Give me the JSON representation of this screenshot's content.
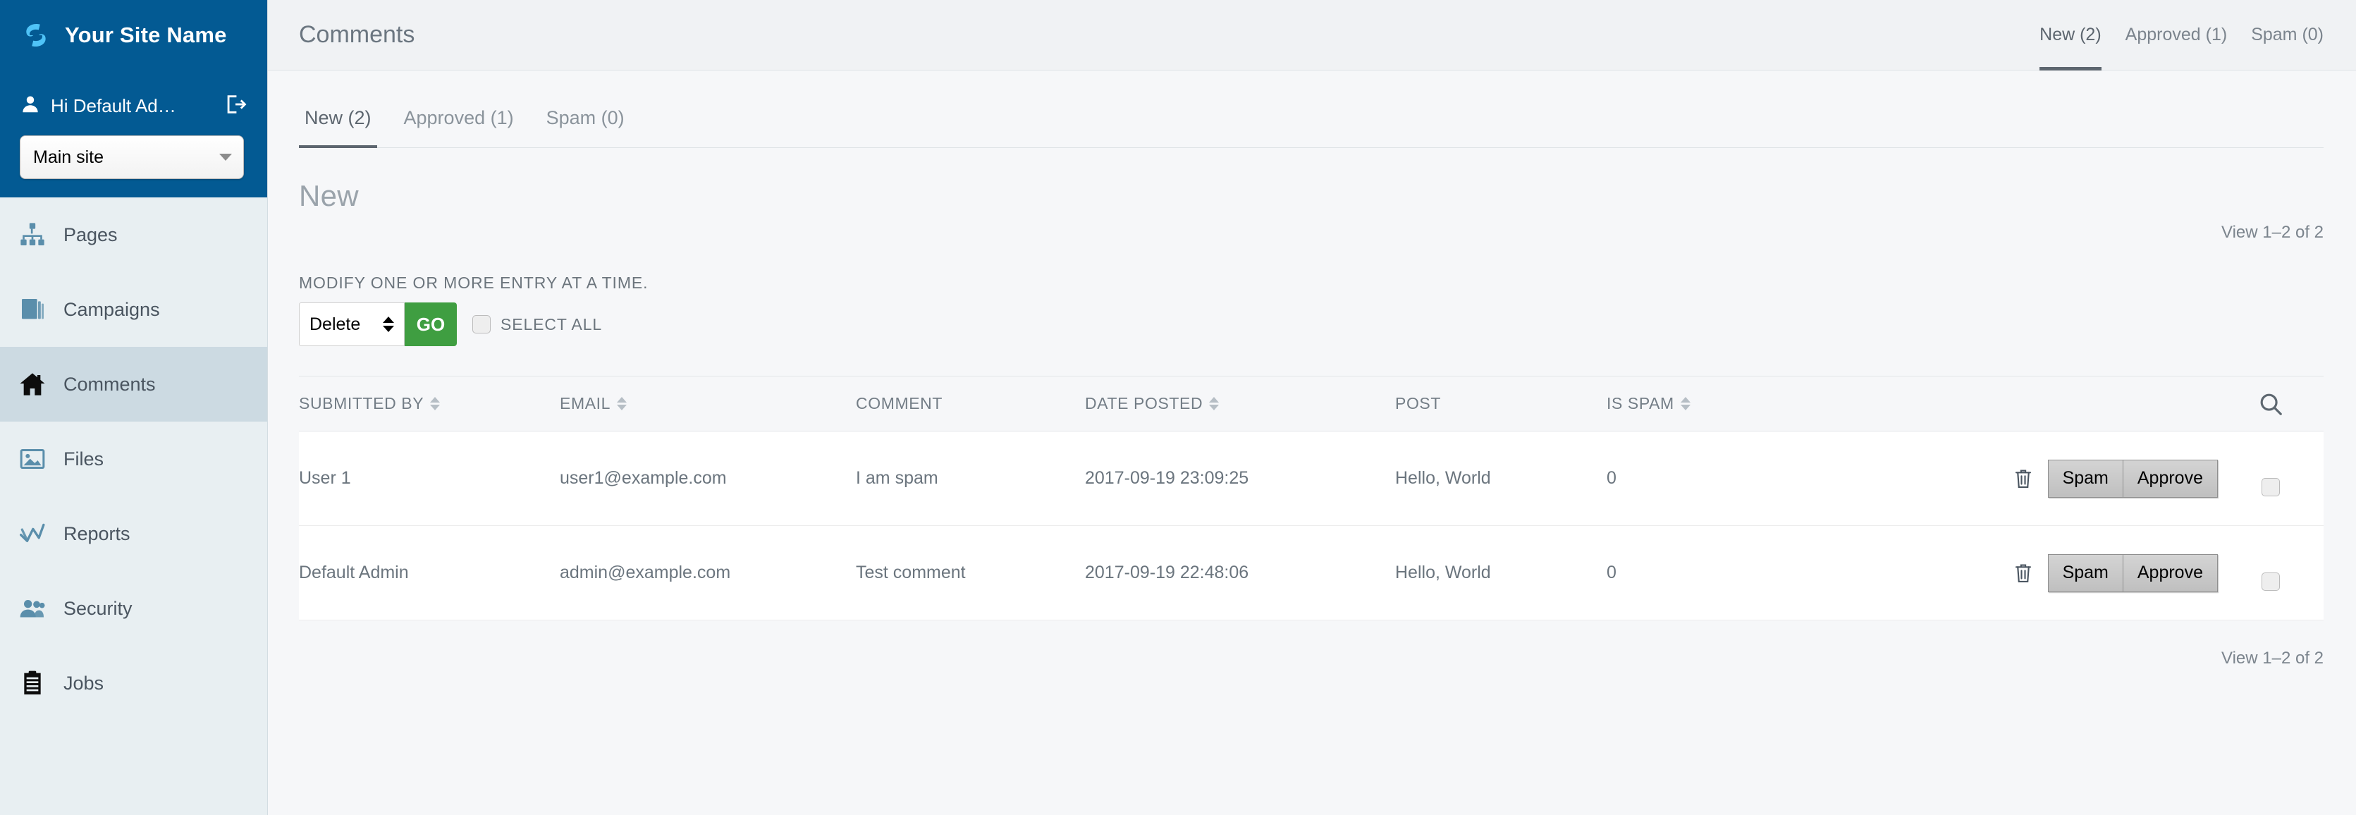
{
  "sidebar": {
    "brand": {
      "logo_icon": "s-swirl-logo-icon",
      "name": "Your Site Name"
    },
    "user": {
      "icon": "user-avatar-icon",
      "greeting": "Hi Default Ad…",
      "logout_icon": "logout-icon"
    },
    "site_selector": {
      "value": "Main site",
      "caret_icon": "chevron-down-icon"
    },
    "items": [
      {
        "label": "Pages",
        "icon": "sitemap-icon",
        "active": false
      },
      {
        "label": "Campaigns",
        "icon": "layers-icon",
        "active": false
      },
      {
        "label": "Comments",
        "icon": "home-icon",
        "active": true
      },
      {
        "label": "Files",
        "icon": "image-icon",
        "active": false
      },
      {
        "label": "Reports",
        "icon": "chart-line-icon",
        "active": false
      },
      {
        "label": "Security",
        "icon": "users-icon",
        "active": false
      },
      {
        "label": "Jobs",
        "icon": "clipboard-icon",
        "active": false
      }
    ]
  },
  "topbar": {
    "title": "Comments",
    "tabs": [
      {
        "label": "New (2)",
        "active": true
      },
      {
        "label": "Approved (1)",
        "active": false
      },
      {
        "label": "Spam (0)",
        "active": false
      }
    ]
  },
  "content": {
    "tabs": [
      {
        "label": "New (2)",
        "active": true
      },
      {
        "label": "Approved (1)",
        "active": false
      },
      {
        "label": "Spam (0)",
        "active": false
      }
    ],
    "section_title": "New",
    "view_count_top": "View 1–2 of 2",
    "view_count_bottom": "View 1–2 of 2",
    "bulk": {
      "label": "MODIFY ONE OR MORE ENTRY AT A TIME.",
      "action_value": "Delete",
      "go_label": "GO",
      "select_all_label": "SELECT ALL",
      "select_all_checked": false
    },
    "table": {
      "search_icon": "search-icon",
      "columns": [
        {
          "label": "SUBMITTED BY",
          "sortable": true
        },
        {
          "label": "EMAIL",
          "sortable": true
        },
        {
          "label": "COMMENT",
          "sortable": false
        },
        {
          "label": "DATE POSTED",
          "sortable": true
        },
        {
          "label": "POST",
          "sortable": false
        },
        {
          "label": "IS SPAM",
          "sortable": true
        }
      ],
      "rows": [
        {
          "submitted_by": "User 1",
          "email": "user1@example.com",
          "comment": "I am spam",
          "date_posted": "2017-09-19 23:09:25",
          "post": "Hello, World",
          "is_spam": "0",
          "delete_icon": "trash-icon",
          "spam_label": "Spam",
          "approve_label": "Approve",
          "selected": false
        },
        {
          "submitted_by": "Default Admin",
          "email": "admin@example.com",
          "comment": "Test comment",
          "date_posted": "2017-09-19 22:48:06",
          "post": "Hello, World",
          "is_spam": "0",
          "delete_icon": "trash-icon",
          "spam_label": "Spam",
          "approve_label": "Approve",
          "selected": false
        }
      ]
    }
  },
  "colors": {
    "brand_blue": "#035a93",
    "sidebar_bg": "#e8eff2",
    "sidebar_active": "#ccdae2",
    "go_green": "#3f9e41",
    "icon_blue": "#5a8eab",
    "text_gray": "#6b757e"
  }
}
